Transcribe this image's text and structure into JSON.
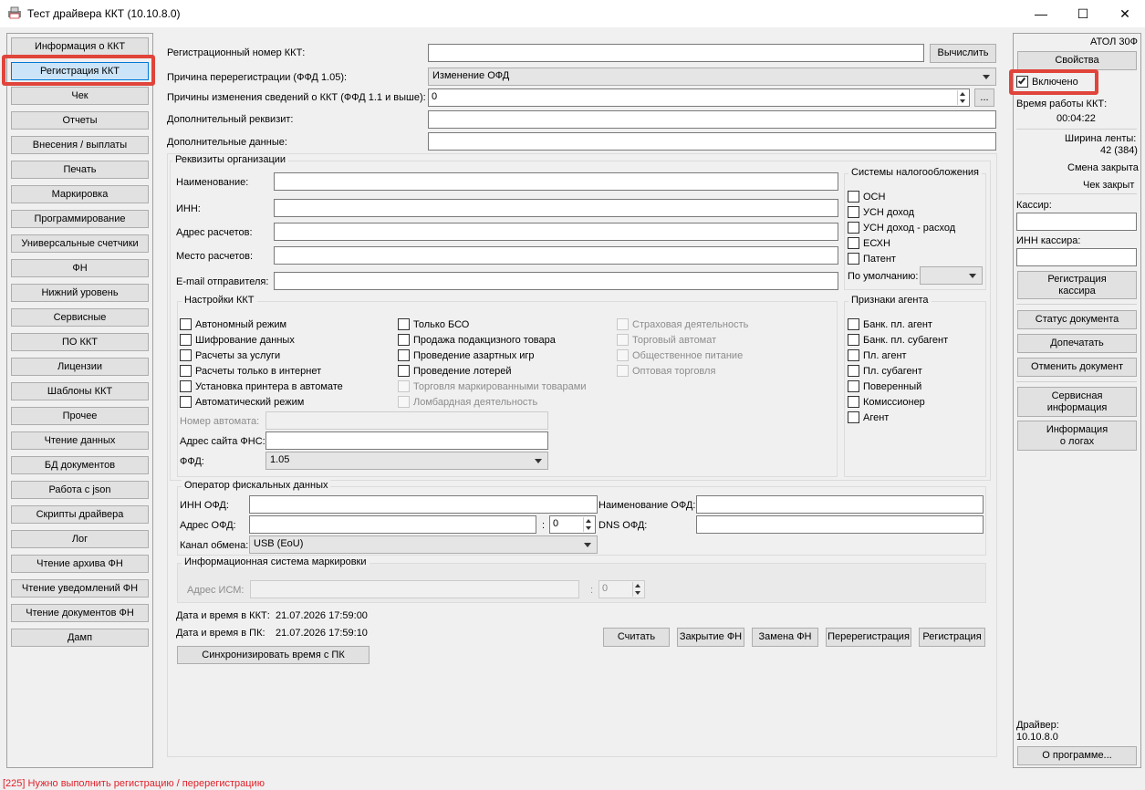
{
  "window": {
    "title": "Тест драйвера ККТ (10.10.8.0)",
    "minimize_glyph": "—",
    "maximize_glyph": "☐",
    "close_glyph": "✕"
  },
  "sidebar": {
    "items": [
      "Информация о ККТ",
      "Регистрация ККТ",
      "Чек",
      "Отчеты",
      "Внесения / выплаты",
      "Печать",
      "Маркировка",
      "Программирование",
      "Универсальные счетчики",
      "ФН",
      "Нижний уровень",
      "Сервисные",
      "ПО ККТ",
      "Лицензии",
      "Шаблоны ККТ",
      "Прочее",
      "Чтение данных",
      "БД документов",
      "Работа с json",
      "Скрипты драйвера",
      "Лог",
      "Чтение архива ФН",
      "Чтение уведомлений ФН",
      "Чтение документов ФН",
      "Дамп"
    ],
    "active_index": 1
  },
  "form": {
    "reg_number_label": "Регистрационный номер ККТ:",
    "reg_number_value": "",
    "calc_button": "Вычислить",
    "rereg_reason_label": "Причина перерегистрации (ФФД 1.05):",
    "rereg_reason_value": "Изменение ОФД",
    "change_reasons_label": "Причины изменения сведений о ККТ (ФФД 1.1 и выше):",
    "change_reasons_value": "0",
    "ellipsis_button": "...",
    "additional_req_label": "Дополнительный реквизит:",
    "additional_req_value": "",
    "additional_data_label": "Дополнительные данные:",
    "additional_data_value": ""
  },
  "org": {
    "title": "Реквизиты организации",
    "name_label": "Наименование:",
    "inn_label": "ИНН:",
    "address_label": "Адрес расчетов:",
    "place_label": "Место расчетов:",
    "email_label": "E-mail отправителя:"
  },
  "tax": {
    "title": "Системы налогообложения",
    "items": [
      "ОСН",
      "УСН доход",
      "УСН доход - расход",
      "ЕСХН",
      "Патент"
    ],
    "default_label": "По умолчанию:",
    "default_value": ""
  },
  "settings": {
    "title": "Настройки ККТ",
    "col1": [
      "Автономный режим",
      "Шифрование данных",
      "Расчеты за услуги",
      "Расчеты только в интернет",
      "Установка принтера в автомате",
      "Автоматический режим"
    ],
    "col2": [
      "Только БСО",
      "Продажа подакцизного товара",
      "Проведение азартных игр",
      "Проведение лотерей",
      "Торговля маркированными товарами",
      "Ломбардная деятельность"
    ],
    "col3": [
      "Страховая деятельность",
      "Торговый автомат",
      "Общественное питание",
      "Оптовая торговля"
    ],
    "machine_number_label": "Номер автомата:",
    "fns_site_label": "Адрес сайта ФНС:",
    "ffd_label": "ФФД:",
    "ffd_value": "1.05"
  },
  "agent": {
    "title": "Признаки агента",
    "items": [
      "Банк. пл. агент",
      "Банк. пл. субагент",
      "Пл. агент",
      "Пл. субагент",
      "Поверенный",
      "Комиссионер",
      "Агент"
    ]
  },
  "ofd": {
    "title": "Оператор фискальных данных",
    "inn_label": "ИНН ОФД:",
    "name_label": "Наименование ОФД:",
    "address_label": "Адрес ОФД:",
    "port_sep": ":",
    "port_value": "0",
    "dns_label": "DNS ОФД:",
    "channel_label": "Канал обмена:",
    "channel_value": "USB (EoU)"
  },
  "ism": {
    "title": "Информационная система маркировки",
    "address_label": "Адрес ИСМ:",
    "port_sep": ":",
    "port_value": "0"
  },
  "datetime": {
    "kkt_label": "Дата и время в ККТ:",
    "kkt_value": "21.07.2026 17:59:00",
    "pc_label": "Дата и время в ПК:",
    "pc_value": "21.07.2026 17:59:10",
    "sync_button": "Синхронизировать время с ПК"
  },
  "actions": {
    "read": "Считать",
    "close_fn": "Закрытие ФН",
    "replace_fn": "Замена ФН",
    "rereg": "Перерегистрация",
    "reg": "Регистрация"
  },
  "right": {
    "model": "АТОЛ 30Ф",
    "props_button": "Свойства",
    "enabled_label": "Включено",
    "uptime_label": "Время работы ККТ:",
    "uptime_value": "00:04:22",
    "tape_label": "Ширина ленты:",
    "tape_value": "42 (384)",
    "shift_status": "Смена закрыта",
    "receipt_status": "Чек закрыт",
    "cashier_label": "Кассир:",
    "cashier_value": "",
    "cashier_inn_label": "ИНН кассира:",
    "cashier_inn_value": "",
    "reg_cashier_button": "Регистрация\nкассира",
    "doc_status_button": "Статус документа",
    "reprint_button": "Допечатать",
    "cancel_doc_button": "Отменить документ",
    "service_info_button": "Сервисная\nинформация",
    "log_info_button": "Информация\nо логах",
    "driver_label": "Драйвер:",
    "driver_version": "10.10.8.0",
    "about_button": "О программе..."
  },
  "status_bar": "[225] Нужно выполнить регистрацию / перерегистрацию",
  "colors": {
    "highlight": "#e0443a",
    "status_error": "#e0202a",
    "active_item": "#cce4f7"
  }
}
